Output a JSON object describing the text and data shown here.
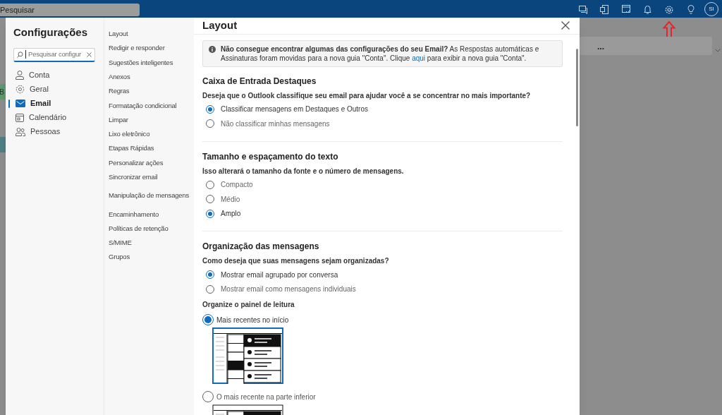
{
  "app_bar": {
    "search_placeholder": "Pesquisar",
    "avatar_initials": "SI"
  },
  "background": {
    "badges": [
      {
        "text": "B",
        "color": "#5f9a6e"
      }
    ],
    "toolbar_more": "..."
  },
  "settings": {
    "title": "Configurações",
    "search_placeholder": "Pesquisar configur",
    "categories": [
      {
        "label": "Conta",
        "selected": false
      },
      {
        "label": "Geral",
        "selected": false
      },
      {
        "label": "Email",
        "selected": true
      },
      {
        "label": "Calendário",
        "selected": false
      },
      {
        "label": "Pessoas",
        "selected": false
      }
    ],
    "subnav_groups": [
      [
        "Layout",
        "Redigir e responder",
        "Sugestões inteligentes",
        "Anexos",
        "Regras",
        "Formatação condicional",
        "Limpar",
        "Lixo eletrônico",
        "Etapas Rápidas",
        "Personalizar ações",
        "Sincronizar email"
      ],
      [
        "Manipulação de mensagens"
      ],
      [
        "Encaminhamento",
        "Políticas de retenção",
        "S/MIME",
        "Grupos"
      ]
    ],
    "panel_title": "Layout",
    "notice": {
      "text_before": "**Não consegue encontrar algumas das configurações do seu Email?** As Respostas automáticas e Assinaturas foram movidas para a nova guia \"Conta\". Clique ",
      "link": "aqui",
      "text_after": " para exibir a nova guia \"Conta\"."
    },
    "sections": [
      {
        "title": "Caixa de Entrada Destaques",
        "question": "Deseja que o Outlook classifique seu email para ajudar você a se concentrar no mais importante?",
        "options": [
          {
            "label": "Classificar mensagens em Destaques e Outros",
            "selected": true
          },
          {
            "label": "Não classificar minhas mensagens",
            "selected": false
          }
        ]
      },
      {
        "title": "Tamanho e espaçamento do texto",
        "question": "Isso alterará o tamanho da fonte e o número de mensagens.",
        "options": [
          {
            "label": "Compacto",
            "selected": false
          },
          {
            "label": "Médio",
            "selected": false
          },
          {
            "label": "Amplo",
            "selected": true
          }
        ]
      },
      {
        "title": "Organização das mensagens",
        "question": "Como deseja que suas mensagens sejam organizadas?",
        "options": [
          {
            "label": "Mostrar email agrupado por conversa",
            "selected": true
          },
          {
            "label": "Mostrar email como mensagens individuais",
            "selected": false
          }
        ],
        "sub_question": "Organize o painel de leitura",
        "pane_options": [
          {
            "label": "Mais recentes no início",
            "selected": true
          },
          {
            "label": "O mais recente na parte inferior",
            "selected": false
          }
        ]
      }
    ]
  }
}
